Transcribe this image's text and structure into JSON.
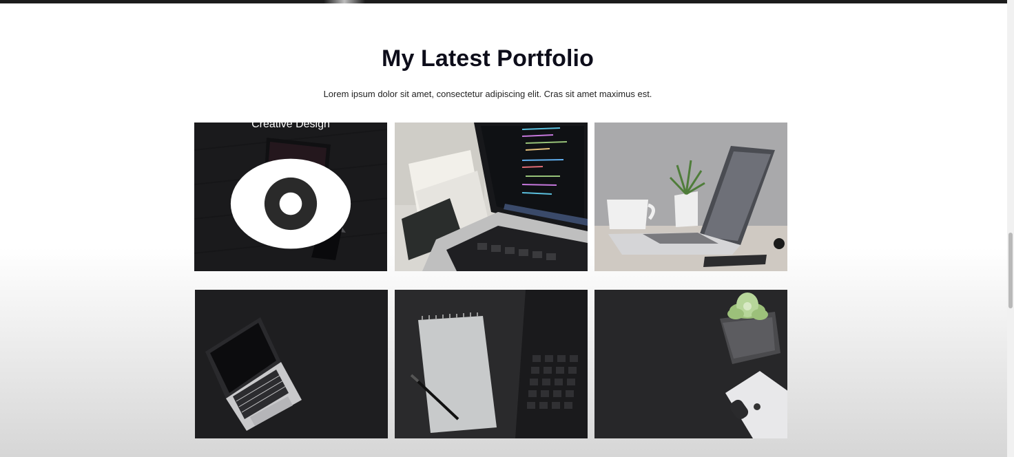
{
  "section": {
    "title": "My Latest Portfolio",
    "subtitle": "Lorem ipsum dolor sit amet, consectetur adipiscing elit. Cras sit amet maximus est."
  },
  "portfolio": {
    "items": [
      {
        "photo": "laptop-dark-desk",
        "hover_label": "Creative Design",
        "icon": "eye-icon"
      },
      {
        "photo": "laptop-code-screen"
      },
      {
        "photo": "laptop-plant-mug"
      },
      {
        "photo": "laptop-top-view-dark"
      },
      {
        "photo": "notebook-pen-keyboard"
      },
      {
        "photo": "succulent-phone-dark"
      }
    ]
  },
  "colors": {
    "heading": "#0d0d1a",
    "overlay": "rgba(0,0,0,0.38)"
  }
}
